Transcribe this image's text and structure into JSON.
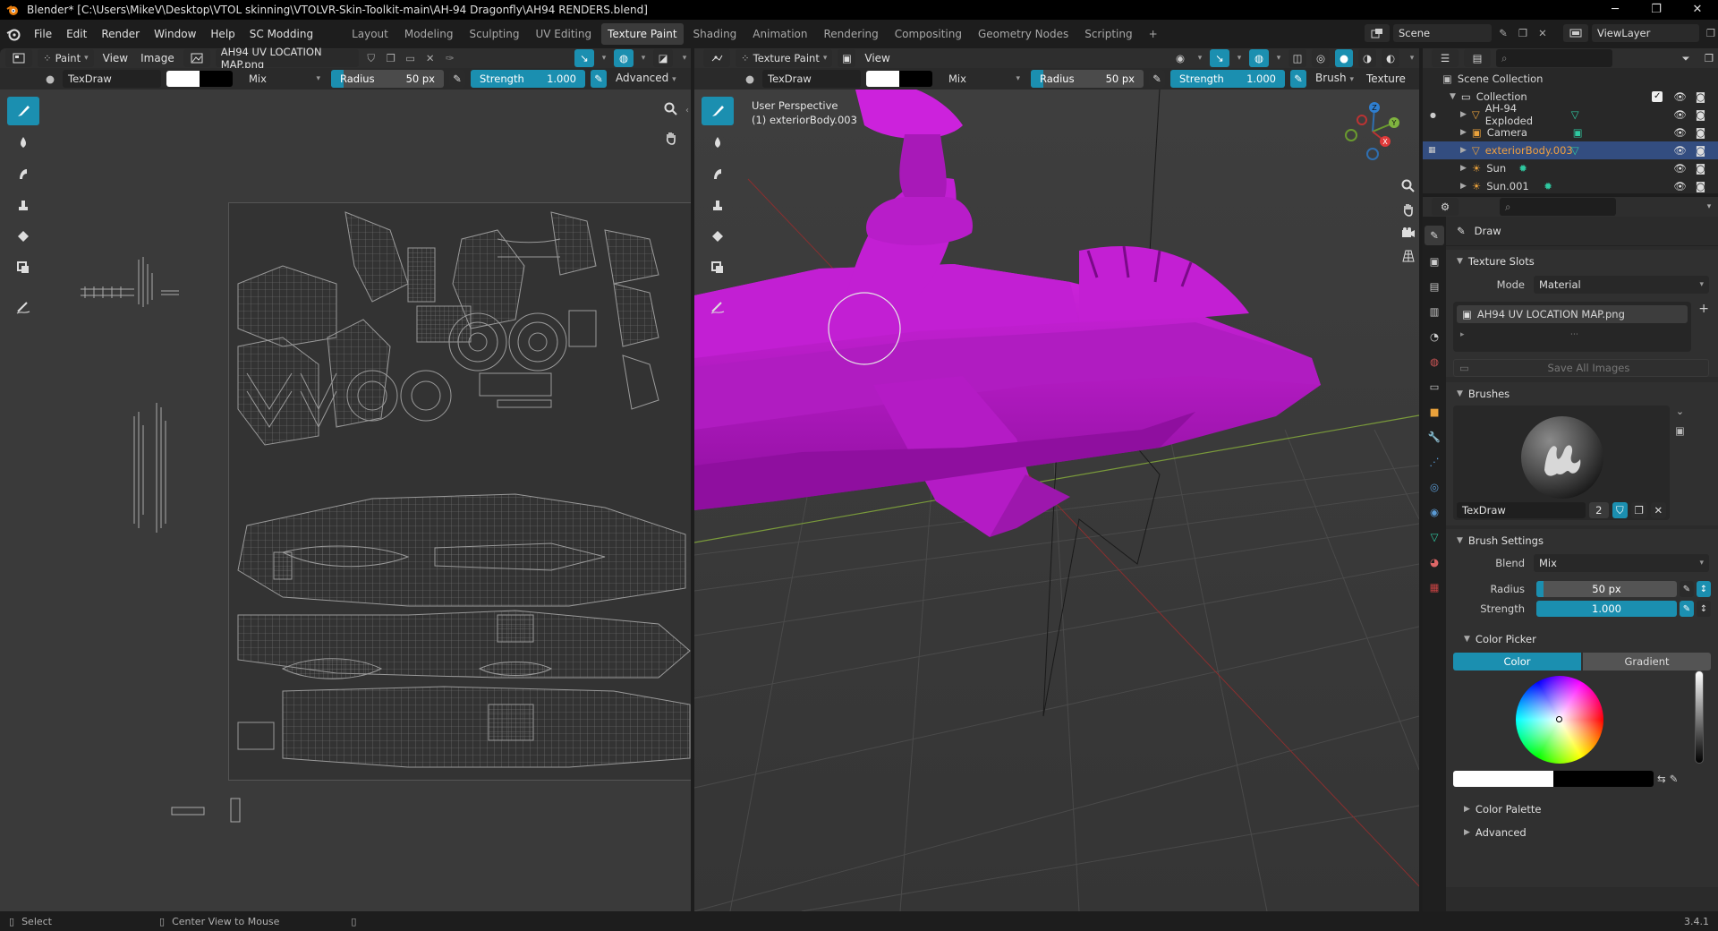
{
  "window": {
    "title": "Blender* [C:\\Users\\MikeV\\Desktop\\VTOL skinning\\VTOLVR-Skin-Toolkit-main\\AH-94 Dragonfly\\AH94 RENDERS.blend]",
    "minimize": "─",
    "maximize": "❐",
    "close": "✕"
  },
  "menu": [
    "File",
    "Edit",
    "Render",
    "Window",
    "Help",
    "SC Modding"
  ],
  "workspaces": [
    "Layout",
    "Modeling",
    "Sculpting",
    "UV Editing",
    "Texture Paint",
    "Shading",
    "Animation",
    "Rendering",
    "Compositing",
    "Geometry Nodes",
    "Scripting"
  ],
  "workspace_add": "+",
  "scene": {
    "label": "Scene",
    "viewlayer": "ViewLayer"
  },
  "image_editor": {
    "mode": "Paint",
    "view": "View",
    "image": "Image",
    "image_name": "AH94 UV LOCATION MAP.png",
    "brush": "TexDraw",
    "blend": "Mix",
    "radius_label": "Radius",
    "radius_value": "50 px",
    "strength_label": "Strength",
    "strength_value": "1.000",
    "advanced": "Advanced"
  },
  "viewport": {
    "mode": "Texture Paint",
    "view": "View",
    "brush": "TexDraw",
    "blend": "Mix",
    "radius_label": "Radius",
    "radius_value": "50 px",
    "strength_label": "Strength",
    "strength_value": "1.000",
    "brush_menu": "Brush",
    "texture_menu": "Texture",
    "overlay_title": "User Perspective",
    "overlay_object": "(1) exteriorBody.003"
  },
  "outliner": {
    "root": "Scene Collection",
    "collection": "Collection",
    "items": [
      {
        "name": "AH-94 Exploded",
        "selected": false
      },
      {
        "name": "Camera",
        "selected": false
      },
      {
        "name": "exteriorBody.003",
        "selected": true
      },
      {
        "name": "Sun",
        "selected": false
      },
      {
        "name": "Sun.001",
        "selected": false
      }
    ]
  },
  "properties": {
    "tool_name": "Draw",
    "texture_slots": {
      "title": "Texture Slots",
      "mode_label": "Mode",
      "mode_value": "Material",
      "slot": "AH94 UV LOCATION MAP.png",
      "save_all": "Save All Images"
    },
    "brushes": {
      "title": "Brushes",
      "name": "TexDraw",
      "users": "2"
    },
    "brush_settings": {
      "title": "Brush Settings",
      "blend_label": "Blend",
      "blend_value": "Mix",
      "radius_label": "Radius",
      "radius_value": "50 px",
      "strength_label": "Strength",
      "strength_value": "1.000"
    },
    "color_picker": {
      "title": "Color Picker",
      "tab_color": "Color",
      "tab_gradient": "Gradient"
    },
    "color_palette": "Color Palette",
    "advanced": "Advanced"
  },
  "status": {
    "select": "Select",
    "center": "Center View to Mouse",
    "version": "3.4.1"
  },
  "colors": {
    "accent": "#1b8fb0",
    "object": "#b516c2",
    "selected_text": "#f0a040"
  }
}
